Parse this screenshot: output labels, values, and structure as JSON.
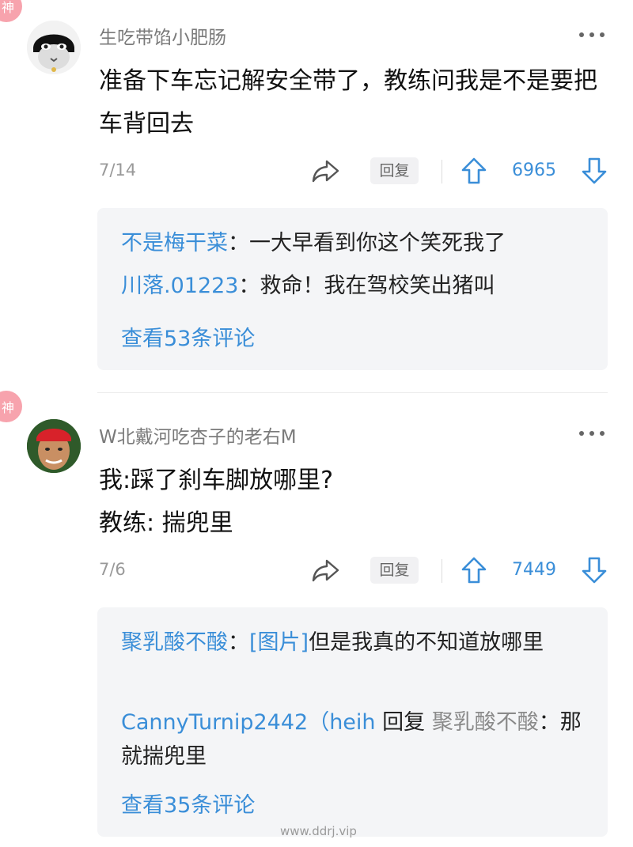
{
  "comments": [
    {
      "badge": "神",
      "username": "生吃带馅小肥肠",
      "content": "准备下车忘记解安全带了，教练问我是不是要把车背回去",
      "date": "7/14",
      "reply_label": "回复",
      "votes": "6965",
      "subreplies": [
        {
          "author": "不是梅干菜",
          "sep": "：",
          "text": "一大早看到你这个笑死我了"
        },
        {
          "author": "川落.01223",
          "sep": "：",
          "text": "救命！我在驾校笑出猪叫"
        }
      ],
      "view_more": "查看53条评论"
    },
    {
      "badge": "神",
      "username": "W北戴河吃杏子的老右M",
      "content_lines": [
        "我:踩了刹车脚放哪里?",
        "教练: 揣兜里"
      ],
      "date": "7/6",
      "reply_label": "回复",
      "votes": "7449",
      "subreplies": [
        {
          "author": "聚乳酸不酸",
          "sep": "：",
          "link": "[图片]",
          "text": "但是我真的不知道放哪里"
        },
        {
          "author": "CannyTurnip2442（heih",
          "reply_word": " 回复 ",
          "target": "聚乳酸不酸",
          "sep": "：",
          "text": "那就揣兜里"
        }
      ],
      "view_more": "查看35条评论"
    }
  ],
  "watermark": "www.ddrj.vip",
  "icons": [
    "more-icon",
    "share-icon",
    "vote-up-icon",
    "vote-down-icon",
    "god-badge",
    "avatar"
  ],
  "colors": {
    "accent": "#3a8ed8",
    "badge": "#f7a3ad",
    "panel": "#f4f5f7"
  }
}
